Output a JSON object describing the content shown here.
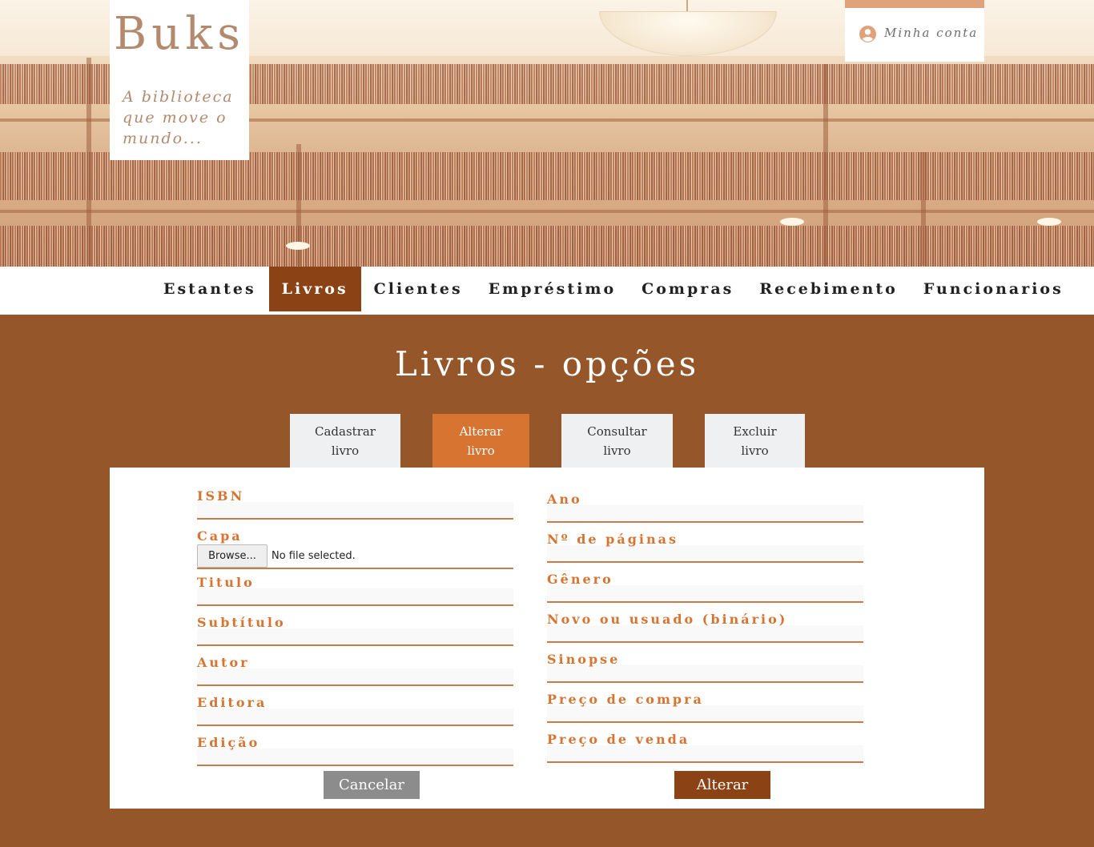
{
  "header": {
    "brand_name": "Buks",
    "brand_tagline": "A biblioteca que move o mundo...",
    "account_label": "Minha conta",
    "account_icon": "user-circle-icon"
  },
  "nav": {
    "items": [
      {
        "label": "Estantes"
      },
      {
        "label": "Livros",
        "active": true
      },
      {
        "label": "Clientes"
      },
      {
        "label": "Empréstimo"
      },
      {
        "label": "Compras"
      },
      {
        "label": "Recebimento"
      },
      {
        "label": "Funcionarios"
      }
    ]
  },
  "main": {
    "title": "Livros - opções",
    "tabs": [
      {
        "line1": "Cadastrar",
        "line2": "livro"
      },
      {
        "line1": "Alterar",
        "line2": "livro",
        "active": true
      },
      {
        "line1": "Consultar",
        "line2": "livro"
      },
      {
        "line1": "Excluir",
        "line2": "livro"
      }
    ]
  },
  "form": {
    "left": {
      "isbn": {
        "label": "ISBN",
        "value": ""
      },
      "capa": {
        "label": "Capa",
        "button": "Browse...",
        "status": "No file selected."
      },
      "titulo": {
        "label": "Titulo",
        "value": ""
      },
      "subtitulo": {
        "label": "Subtítulo",
        "value": ""
      },
      "autor": {
        "label": "Autor",
        "value": ""
      },
      "editora": {
        "label": "Editora",
        "value": ""
      },
      "edicao": {
        "label": "Edição",
        "value": ""
      }
    },
    "right": {
      "ano": {
        "label": "Ano",
        "value": ""
      },
      "paginas": {
        "label": "Nº de páginas",
        "value": ""
      },
      "genero": {
        "label": "Gênero",
        "value": ""
      },
      "novo_usado": {
        "label": "Novo ou usuado (binário)",
        "value": ""
      },
      "sinopse": {
        "label": "Sinopse",
        "value": ""
      },
      "preco_compra": {
        "label": "Preço de compra",
        "value": ""
      },
      "preco_venda": {
        "label": "Preço de venda",
        "value": ""
      }
    },
    "cancel_label": "Cancelar",
    "submit_label": "Alterar"
  },
  "colors": {
    "page_background": "#95562a",
    "nav_active": "#8b4316",
    "accent": "#d77432",
    "brand_text": "#b48a6e",
    "cancel_button": "#8c8c8c"
  }
}
